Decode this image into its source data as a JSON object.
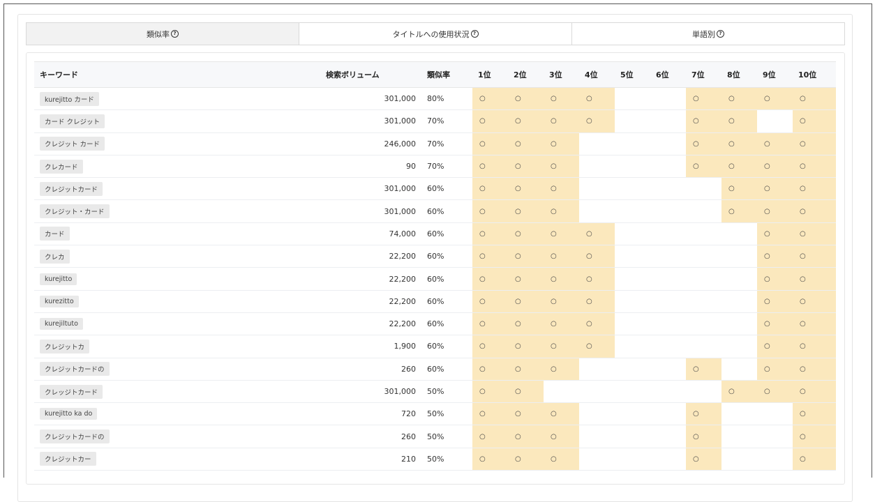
{
  "tabs": [
    {
      "label": "類似率",
      "active": true
    },
    {
      "label": "タイトルへの使用状況",
      "active": false
    },
    {
      "label": "単語別",
      "active": false
    }
  ],
  "help_glyph": "?",
  "table": {
    "headers": {
      "keyword": "キーワード",
      "volume": "検索ボリューム",
      "similarity": "類似率",
      "ranks": [
        "1位",
        "2位",
        "3位",
        "4位",
        "5位",
        "6位",
        "7位",
        "8位",
        "9位",
        "10位"
      ]
    },
    "mark": "○",
    "highlight_color": "#fbe8bd",
    "rows": [
      {
        "keyword": "kurejitto カード",
        "volume": "301,000",
        "similarity": "80%",
        "ranks": [
          1,
          1,
          1,
          1,
          0,
          0,
          1,
          1,
          1,
          1
        ]
      },
      {
        "keyword": "カード クレジット",
        "volume": "301,000",
        "similarity": "70%",
        "ranks": [
          1,
          1,
          1,
          1,
          0,
          0,
          1,
          1,
          0,
          1
        ]
      },
      {
        "keyword": "クレジット カード",
        "volume": "246,000",
        "similarity": "70%",
        "ranks": [
          1,
          1,
          1,
          0,
          0,
          0,
          1,
          1,
          1,
          1
        ]
      },
      {
        "keyword": "クレカード",
        "volume": "90",
        "similarity": "70%",
        "ranks": [
          1,
          1,
          1,
          0,
          0,
          0,
          1,
          1,
          1,
          1
        ]
      },
      {
        "keyword": "クレジットカード",
        "volume": "301,000",
        "similarity": "60%",
        "ranks": [
          1,
          1,
          1,
          0,
          0,
          0,
          0,
          1,
          1,
          1
        ]
      },
      {
        "keyword": "クレジット・カード",
        "volume": "301,000",
        "similarity": "60%",
        "ranks": [
          1,
          1,
          1,
          0,
          0,
          0,
          0,
          1,
          1,
          1
        ]
      },
      {
        "keyword": "カード",
        "volume": "74,000",
        "similarity": "60%",
        "ranks": [
          1,
          1,
          1,
          1,
          0,
          0,
          0,
          0,
          1,
          1
        ]
      },
      {
        "keyword": "クレカ",
        "volume": "22,200",
        "similarity": "60%",
        "ranks": [
          1,
          1,
          1,
          1,
          0,
          0,
          0,
          0,
          1,
          1
        ]
      },
      {
        "keyword": "kurejitto",
        "volume": "22,200",
        "similarity": "60%",
        "ranks": [
          1,
          1,
          1,
          1,
          0,
          0,
          0,
          0,
          1,
          1
        ]
      },
      {
        "keyword": "kurezitto",
        "volume": "22,200",
        "similarity": "60%",
        "ranks": [
          1,
          1,
          1,
          1,
          0,
          0,
          0,
          0,
          1,
          1
        ]
      },
      {
        "keyword": "kurejiltuto",
        "volume": "22,200",
        "similarity": "60%",
        "ranks": [
          1,
          1,
          1,
          1,
          0,
          0,
          0,
          0,
          1,
          1
        ]
      },
      {
        "keyword": "クレジットカ",
        "volume": "1,900",
        "similarity": "60%",
        "ranks": [
          1,
          1,
          1,
          1,
          0,
          0,
          0,
          0,
          1,
          1
        ]
      },
      {
        "keyword": "クレジットカードの",
        "volume": "260",
        "similarity": "60%",
        "ranks": [
          1,
          1,
          1,
          0,
          0,
          0,
          1,
          0,
          1,
          1
        ]
      },
      {
        "keyword": "クレッジトカード",
        "volume": "301,000",
        "similarity": "50%",
        "ranks": [
          1,
          1,
          0,
          0,
          0,
          0,
          0,
          1,
          1,
          1
        ]
      },
      {
        "keyword": "kurejitto ka do",
        "volume": "720",
        "similarity": "50%",
        "ranks": [
          1,
          1,
          1,
          0,
          0,
          0,
          1,
          0,
          0,
          1
        ]
      },
      {
        "keyword": "クレジットカードの",
        "volume": "260",
        "similarity": "50%",
        "ranks": [
          1,
          1,
          1,
          0,
          0,
          0,
          1,
          0,
          0,
          1
        ]
      },
      {
        "keyword": "クレジットカー",
        "volume": "210",
        "similarity": "50%",
        "ranks": [
          1,
          1,
          1,
          0,
          0,
          0,
          1,
          0,
          0,
          1
        ]
      }
    ]
  }
}
